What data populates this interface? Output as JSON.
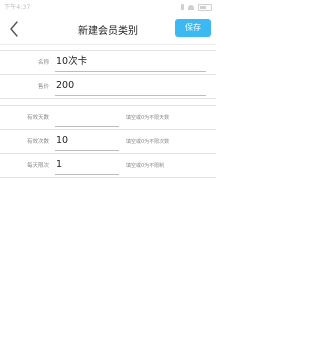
{
  "status_bar": {
    "time": "下午4:37"
  },
  "nav": {
    "title": "新建会员类别",
    "save_label": "保存"
  },
  "form": {
    "name": {
      "label": "名称",
      "value": "10次卡"
    },
    "price": {
      "label": "售价",
      "value": "200"
    },
    "valid_days": {
      "label": "有效天数",
      "value": "",
      "hint": "填空或0为不限天数"
    },
    "valid_times": {
      "label": "有效次数",
      "value": "10",
      "hint": "填空或0为不限次数"
    },
    "daily_times": {
      "label": "每天限次",
      "value": "1",
      "hint": "填空或0为不限制"
    }
  },
  "colors": {
    "accent": "#3cb9f2",
    "divider": "#e3e3e3",
    "label": "#888888"
  },
  "icons": {
    "back": "chevron-left-icon",
    "bluetooth": "bluetooth-icon",
    "wifi": "wifi-icon",
    "battery": "battery-icon"
  }
}
